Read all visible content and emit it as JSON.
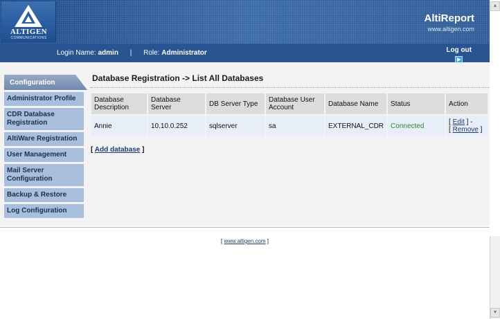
{
  "header": {
    "logo_text": "ALTIGEN",
    "logo_sub": "COMMUNICATIONS",
    "brand_name": "AltiReport",
    "brand_url": "www.altigen.com"
  },
  "login_bar": {
    "login_label": "Login Name:",
    "login_value": "admin",
    "separator": "|",
    "role_label": "Role:",
    "role_value": "Administrator",
    "logout_label": "Log out"
  },
  "sidebar": {
    "tab_label": "Configuration",
    "items": [
      {
        "label": "Administrator Profile"
      },
      {
        "label": "CDR Database Registration"
      },
      {
        "label": "AltiWare Registration"
      },
      {
        "label": "User Management"
      },
      {
        "label": "Mail Server Configuration"
      },
      {
        "label": "Backup & Restore"
      },
      {
        "label": "Log Configuration"
      }
    ]
  },
  "main": {
    "page_title": "Database Registration -> List All Databases",
    "columns": [
      "Database Description",
      "Database Server",
      "DB Server Type",
      "Database User Account",
      "Database Name",
      "Status",
      "Action"
    ],
    "rows": [
      {
        "description": "Annie",
        "server": "10.10.0.252",
        "server_type": "sqlserver",
        "user_account": "sa",
        "db_name": "EXTERNAL_CDR",
        "status": "Connected",
        "edit_label": "Edit",
        "remove_label": "Remove"
      }
    ],
    "add_database_label": "Add database"
  },
  "footer": {
    "link_label": "www.altigen.com"
  },
  "colors": {
    "header_blue": "#2d5b96",
    "sidebar_item": "#a8bfdb",
    "status_connected": "#2a8a2a"
  }
}
